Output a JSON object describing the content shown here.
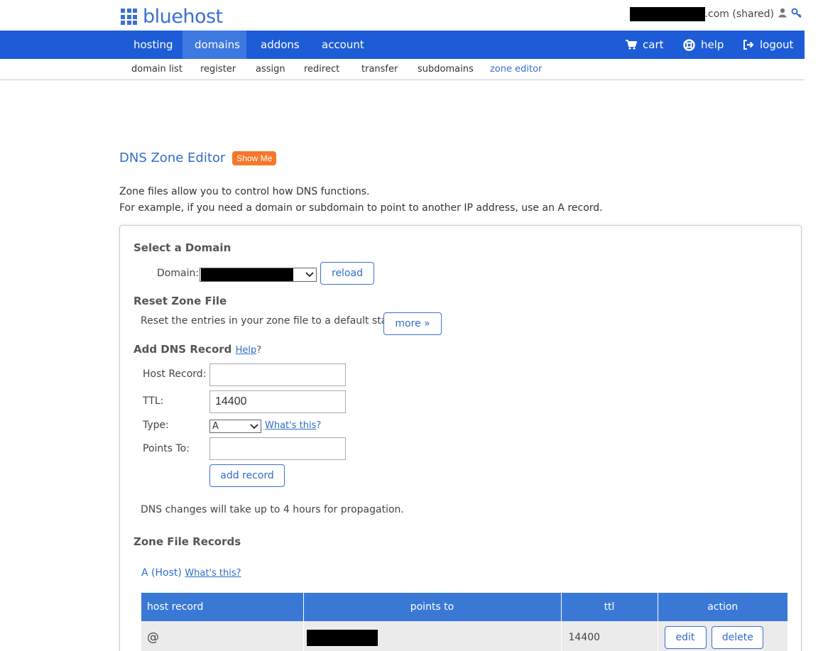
{
  "header": {
    "logo_text": "bluehost",
    "account_suffix": ".com (shared)",
    "brand_color": "#1d5cd6"
  },
  "nav": {
    "items": [
      {
        "label": "hosting"
      },
      {
        "label": "domains"
      },
      {
        "label": "addons"
      },
      {
        "label": "account"
      }
    ],
    "active": "domains",
    "right": [
      {
        "label": "cart",
        "icon": "cart-icon"
      },
      {
        "label": "help",
        "icon": "lifebuoy-icon"
      },
      {
        "label": "logout",
        "icon": "logout-icon"
      }
    ]
  },
  "subnav": {
    "items": [
      {
        "label": "domain list"
      },
      {
        "label": "register"
      },
      {
        "label": "assign"
      },
      {
        "label": "redirect"
      },
      {
        "label": "transfer"
      },
      {
        "label": "subdomains"
      },
      {
        "label": "zone editor"
      }
    ],
    "active": "zone editor"
  },
  "page": {
    "title": "DNS Zone Editor",
    "show_me": "Show Me",
    "intro_line1": "Zone files allow you to control how DNS functions.",
    "intro_line2": "For example, if you need a domain or subdomain to point to another IP address, use an A record."
  },
  "select_domain": {
    "heading": "Select a Domain",
    "domain_label": "Domain:",
    "reload_label": "reload"
  },
  "reset_zone": {
    "heading": "Reset Zone File",
    "text": "Reset the entries in your zone file to a default state.",
    "more_label": "more »"
  },
  "add_record": {
    "heading": "Add DNS Record",
    "help_link": "Help",
    "help_suffix": "?",
    "host_label": "Host Record:",
    "host_value": "",
    "ttl_label": "TTL:",
    "ttl_value": "14400",
    "type_label": "Type:",
    "type_value": "A",
    "whats_this": "What's this",
    "whats_suffix": "?",
    "points_label": "Points To:",
    "points_value": "",
    "add_label": "add record",
    "propagation_note": "DNS changes will take up to 4 hours for propagation."
  },
  "zone_records": {
    "heading": "Zone File Records",
    "a_section": "A (Host)",
    "a_whats_this": "What's this?",
    "columns": [
      "host record",
      "points to",
      "ttl",
      "action"
    ],
    "rows": [
      {
        "host": "@",
        "ttl": "14400",
        "edit": "edit",
        "delete": "delete"
      }
    ]
  }
}
